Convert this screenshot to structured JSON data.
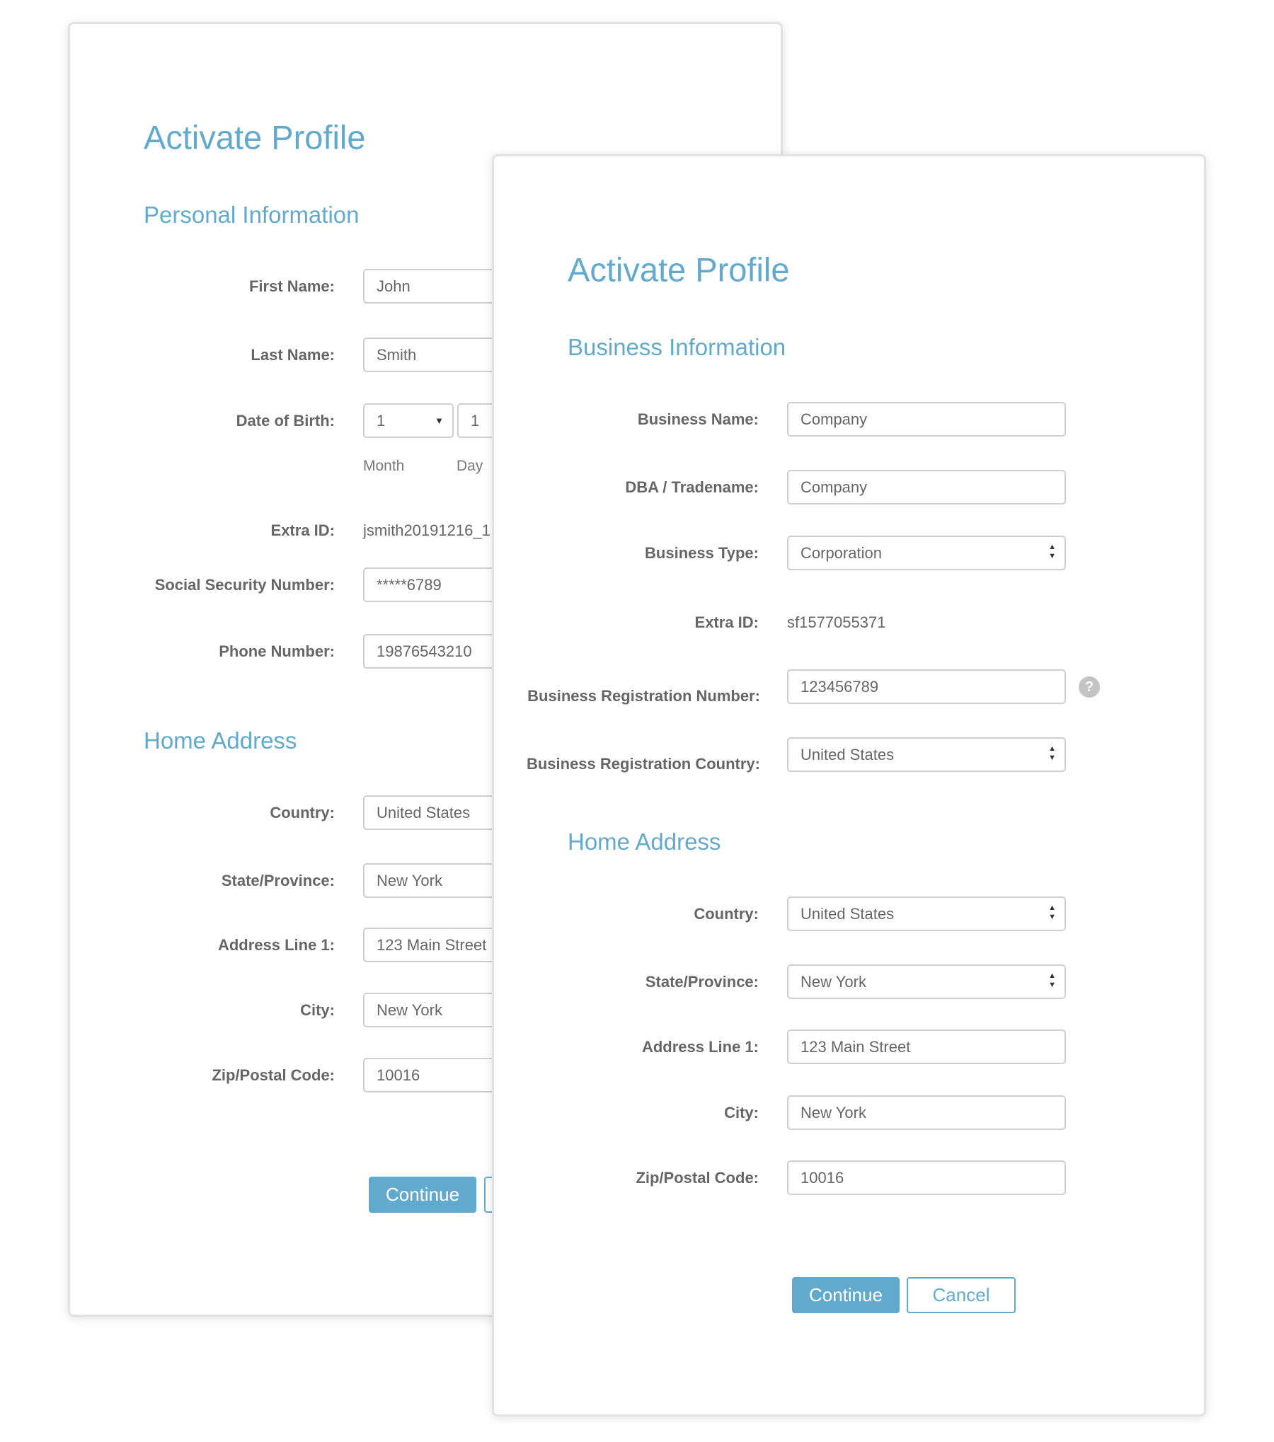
{
  "accent_color": "#62aacd",
  "back_form": {
    "title": "Activate Profile",
    "section_personal": "Personal Information",
    "first_name": {
      "label": "First Name:",
      "value": "John"
    },
    "last_name": {
      "label": "Last Name:",
      "value": "Smith"
    },
    "dob": {
      "label": "Date of Birth:",
      "month": "1",
      "day": "1",
      "month_label": "Month",
      "day_label": "Day"
    },
    "extra_id": {
      "label": "Extra ID:",
      "value": "jsmith20191216_1"
    },
    "ssn": {
      "label": "Social Security Number:",
      "value": "*****6789"
    },
    "phone": {
      "label": "Phone Number:",
      "value": "19876543210"
    },
    "section_address": "Home Address",
    "country": {
      "label": "Country:",
      "value": "United States"
    },
    "state": {
      "label": "State/Province:",
      "value": "New York"
    },
    "address1": {
      "label": "Address Line 1:",
      "value": "123 Main Street"
    },
    "city": {
      "label": "City:",
      "value": "New York"
    },
    "zip": {
      "label": "Zip/Postal Code:",
      "value": "10016"
    },
    "continue_label": "Continue"
  },
  "front_form": {
    "title": "Activate Profile",
    "section_business": "Business Information",
    "business_name": {
      "label": "Business Name:",
      "value": "Company"
    },
    "dba": {
      "label": "DBA / Tradename:",
      "value": "Company"
    },
    "business_type": {
      "label": "Business Type:",
      "value": "Corporation"
    },
    "extra_id": {
      "label": "Extra ID:",
      "value": "sf1577055371"
    },
    "reg_number": {
      "label": "Business Registration Number:",
      "value": "123456789",
      "help": "?"
    },
    "reg_country": {
      "label": "Business Registration Country:",
      "value": "United States"
    },
    "section_address": "Home Address",
    "country": {
      "label": "Country:",
      "value": "United States"
    },
    "state": {
      "label": "State/Province:",
      "value": "New York"
    },
    "address1": {
      "label": "Address Line 1:",
      "value": "123 Main Street"
    },
    "city": {
      "label": "City:",
      "value": "New York"
    },
    "zip": {
      "label": "Zip/Postal Code:",
      "value": "10016"
    },
    "continue_label": "Continue",
    "cancel_label": "Cancel"
  }
}
